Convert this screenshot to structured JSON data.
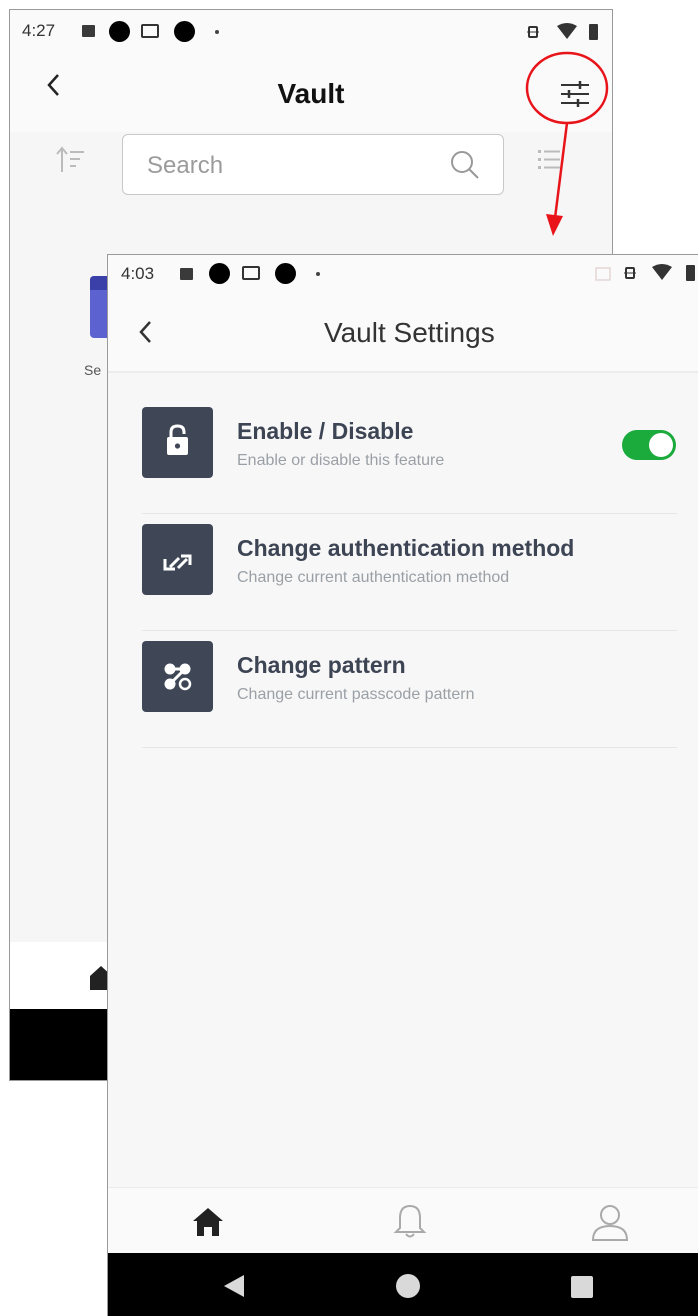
{
  "back_screen": {
    "status_time": "4:27",
    "title": "Vault",
    "search_placeholder": "Search",
    "partial_label": "Se"
  },
  "front_screen": {
    "status_time": "4:03",
    "title": "Vault Settings",
    "items": [
      {
        "title": "Enable / Disable",
        "subtitle": "Enable or disable this feature",
        "icon": "lock-icon",
        "toggle_on": true
      },
      {
        "title": "Change authentication method",
        "subtitle": "Change current authentication method",
        "icon": "swap-arrows-icon"
      },
      {
        "title": "Change pattern",
        "subtitle": "Change current passcode pattern",
        "icon": "pattern-icon"
      }
    ],
    "bottom_nav": [
      "home-icon",
      "bell-icon",
      "profile-icon"
    ]
  },
  "colors": {
    "accent_toggle": "#1aab3c",
    "icon_tile": "#3f4757",
    "annotation": "#e8141a"
  }
}
